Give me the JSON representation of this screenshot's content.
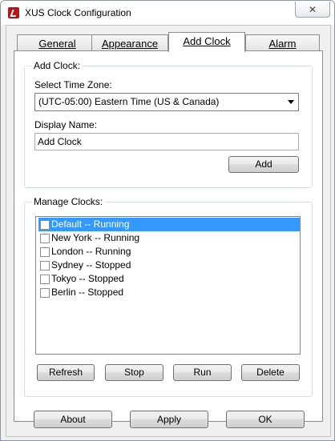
{
  "window": {
    "title": "XUS Clock Configuration",
    "close_glyph": "✕"
  },
  "tabs": [
    {
      "label": "General"
    },
    {
      "label": "Appearance"
    },
    {
      "label": "Add Clock"
    },
    {
      "label": "Alarm"
    }
  ],
  "add_clock": {
    "group_label": "Add Clock:",
    "timezone_label": "Select Time Zone:",
    "timezone_value": "(UTC-05:00) Eastern Time (US & Canada)",
    "display_name_label": "Display Name:",
    "display_name_value": "Add Clock",
    "add_button": "Add"
  },
  "manage_clocks": {
    "group_label": "Manage Clocks:",
    "items": [
      {
        "label": "Default -- Running",
        "checked": false,
        "selected": true
      },
      {
        "label": "New York -- Running",
        "checked": false,
        "selected": false
      },
      {
        "label": "London -- Running",
        "checked": false,
        "selected": false
      },
      {
        "label": "Sydney -- Stopped",
        "checked": false,
        "selected": false
      },
      {
        "label": "Tokyo -- Stopped",
        "checked": false,
        "selected": false
      },
      {
        "label": "Berlin -- Stopped",
        "checked": false,
        "selected": false
      }
    ],
    "buttons": {
      "refresh": "Refresh",
      "stop": "Stop",
      "run": "Run",
      "delete": "Delete"
    }
  },
  "footer": {
    "about": "About",
    "apply": "Apply",
    "ok": "OK"
  }
}
